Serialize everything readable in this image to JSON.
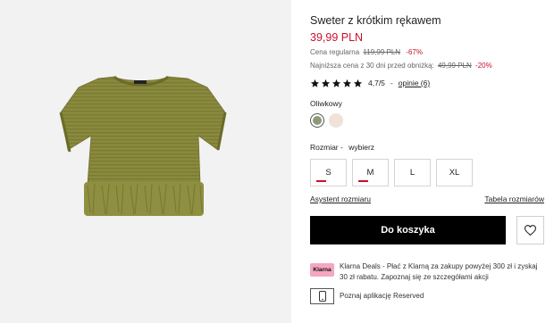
{
  "product": {
    "title": "Sweter z krótkim rękawem",
    "price": "39,99 PLN",
    "regular_label": "Cena regularna",
    "regular_price": "119,99 PLN",
    "regular_discount": "-67%",
    "lowest_label": "Najniższa cena z 30 dni przed obniżką:",
    "lowest_price": "49,99 PLN",
    "lowest_discount": "-20%",
    "image_icon": "olive-short-sleeve-sweater-with-fringe-hem"
  },
  "rating": {
    "stars": 5,
    "value": "4,7/5",
    "separator": "-",
    "reviews_label": "opinie (6)"
  },
  "color": {
    "name": "Oliwkowy",
    "swatches": [
      "#8e9a76",
      "#efe2d8"
    ]
  },
  "size": {
    "label": "Rozmiar -",
    "choose": "wybierz",
    "options": [
      {
        "label": "S",
        "low_stock": true
      },
      {
        "label": "M",
        "low_stock": true
      },
      {
        "label": "L",
        "low_stock": false
      },
      {
        "label": "XL",
        "low_stock": false
      }
    ],
    "assistant_link": "Asystent rozmiaru",
    "table_link": "Tabela rozmiarów"
  },
  "actions": {
    "add_to_cart": "Do koszyka",
    "wishlist_icon": "heart-icon"
  },
  "klarna": {
    "logo": "Klarna",
    "text": "Klarna Deals - Płać z Klarną za zakupy powyżej 300 zł i zyskaj 30 zł rabatu. Zapoznaj się ze szczegółami akcji"
  },
  "app": {
    "icon": "phone-icon",
    "text": "Poznaj aplikację Reserved"
  },
  "colors": {
    "accent_red": "#c8102e",
    "button_black": "#000000",
    "klarna_pink": "#f5a6c1",
    "image_bg": "#f2f2f2"
  }
}
